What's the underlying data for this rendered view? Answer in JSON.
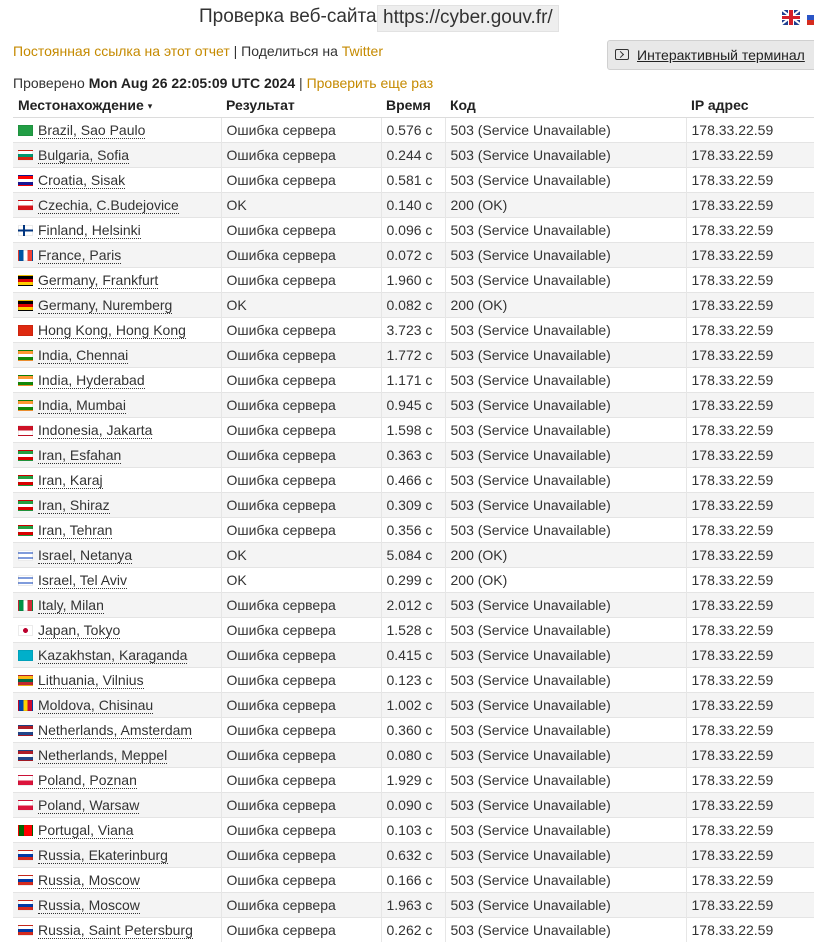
{
  "header": {
    "title": "Проверка веб-сайта",
    "url": "https://cyber.gouv.fr/"
  },
  "links": {
    "permalink": "Постоянная ссылка на этот отчет",
    "separator": "|",
    "share_prefix": "Поделиться на",
    "twitter": "Twitter"
  },
  "terminal_button": {
    "label": "Интерактивный терминал"
  },
  "checked": {
    "prefix": "Проверено",
    "datetime": "Mon Aug 26 22:05:09 UTC 2024",
    "separator": "|",
    "recheck": "Проверить еще раз"
  },
  "table": {
    "headers": {
      "location": "Местонахождение",
      "sort_arrow": "▾",
      "result": "Результат",
      "time": "Время",
      "code": "Код",
      "ip": "IP адрес"
    },
    "rows": [
      {
        "flag": "br",
        "location": "Brazil, Sao Paulo",
        "result": "Ошибка сервера",
        "time": "0.576 с",
        "code": "503 (Service Unavailable)",
        "ip": "178.33.22.59",
        "error": true
      },
      {
        "flag": "bg",
        "location": "Bulgaria, Sofia",
        "result": "Ошибка сервера",
        "time": "0.244 с",
        "code": "503 (Service Unavailable)",
        "ip": "178.33.22.59",
        "error": true
      },
      {
        "flag": "hr",
        "location": "Croatia, Sisak",
        "result": "Ошибка сервера",
        "time": "0.581 с",
        "code": "503 (Service Unavailable)",
        "ip": "178.33.22.59",
        "error": true
      },
      {
        "flag": "cz",
        "location": "Czechia, C.Budejovice",
        "result": "OK",
        "time": "0.140 с",
        "code": "200 (OK)",
        "ip": "178.33.22.59",
        "error": false
      },
      {
        "flag": "fi",
        "location": "Finland, Helsinki",
        "result": "Ошибка сервера",
        "time": "0.096 с",
        "code": "503 (Service Unavailable)",
        "ip": "178.33.22.59",
        "error": true
      },
      {
        "flag": "fr",
        "location": "France, Paris",
        "result": "Ошибка сервера",
        "time": "0.072 с",
        "code": "503 (Service Unavailable)",
        "ip": "178.33.22.59",
        "error": true
      },
      {
        "flag": "de",
        "location": "Germany, Frankfurt",
        "result": "Ошибка сервера",
        "time": "1.960 с",
        "code": "503 (Service Unavailable)",
        "ip": "178.33.22.59",
        "error": true
      },
      {
        "flag": "de",
        "location": "Germany, Nuremberg",
        "result": "OK",
        "time": "0.082 с",
        "code": "200 (OK)",
        "ip": "178.33.22.59",
        "error": false
      },
      {
        "flag": "hk",
        "location": "Hong Kong, Hong Kong",
        "result": "Ошибка сервера",
        "time": "3.723 с",
        "code": "503 (Service Unavailable)",
        "ip": "178.33.22.59",
        "error": true
      },
      {
        "flag": "in",
        "location": "India, Chennai",
        "result": "Ошибка сервера",
        "time": "1.772 с",
        "code": "503 (Service Unavailable)",
        "ip": "178.33.22.59",
        "error": true
      },
      {
        "flag": "in",
        "location": "India, Hyderabad",
        "result": "Ошибка сервера",
        "time": "1.171 с",
        "code": "503 (Service Unavailable)",
        "ip": "178.33.22.59",
        "error": true
      },
      {
        "flag": "in",
        "location": "India, Mumbai",
        "result": "Ошибка сервера",
        "time": "0.945 с",
        "code": "503 (Service Unavailable)",
        "ip": "178.33.22.59",
        "error": true
      },
      {
        "flag": "id",
        "location": "Indonesia, Jakarta",
        "result": "Ошибка сервера",
        "time": "1.598 с",
        "code": "503 (Service Unavailable)",
        "ip": "178.33.22.59",
        "error": true
      },
      {
        "flag": "ir",
        "location": "Iran, Esfahan",
        "result": "Ошибка сервера",
        "time": "0.363 с",
        "code": "503 (Service Unavailable)",
        "ip": "178.33.22.59",
        "error": true
      },
      {
        "flag": "ir",
        "location": "Iran, Karaj",
        "result": "Ошибка сервера",
        "time": "0.466 с",
        "code": "503 (Service Unavailable)",
        "ip": "178.33.22.59",
        "error": true
      },
      {
        "flag": "ir",
        "location": "Iran, Shiraz",
        "result": "Ошибка сервера",
        "time": "0.309 с",
        "code": "503 (Service Unavailable)",
        "ip": "178.33.22.59",
        "error": true
      },
      {
        "flag": "ir",
        "location": "Iran, Tehran",
        "result": "Ошибка сервера",
        "time": "0.356 с",
        "code": "503 (Service Unavailable)",
        "ip": "178.33.22.59",
        "error": true
      },
      {
        "flag": "il",
        "location": "Israel, Netanya",
        "result": "OK",
        "time": "5.084 с",
        "code": "200 (OK)",
        "ip": "178.33.22.59",
        "error": false
      },
      {
        "flag": "il",
        "location": "Israel, Tel Aviv",
        "result": "OK",
        "time": "0.299 с",
        "code": "200 (OK)",
        "ip": "178.33.22.59",
        "error": false
      },
      {
        "flag": "it",
        "location": "Italy, Milan",
        "result": "Ошибка сервера",
        "time": "2.012 с",
        "code": "503 (Service Unavailable)",
        "ip": "178.33.22.59",
        "error": true
      },
      {
        "flag": "jp",
        "location": "Japan, Tokyo",
        "result": "Ошибка сервера",
        "time": "1.528 с",
        "code": "503 (Service Unavailable)",
        "ip": "178.33.22.59",
        "error": true
      },
      {
        "flag": "kz",
        "location": "Kazakhstan, Karaganda",
        "result": "Ошибка сервера",
        "time": "0.415 с",
        "code": "503 (Service Unavailable)",
        "ip": "178.33.22.59",
        "error": true
      },
      {
        "flag": "lt",
        "location": "Lithuania, Vilnius",
        "result": "Ошибка сервера",
        "time": "0.123 с",
        "code": "503 (Service Unavailable)",
        "ip": "178.33.22.59",
        "error": true
      },
      {
        "flag": "md",
        "location": "Moldova, Chisinau",
        "result": "Ошибка сервера",
        "time": "1.002 с",
        "code": "503 (Service Unavailable)",
        "ip": "178.33.22.59",
        "error": true
      },
      {
        "flag": "nl",
        "location": "Netherlands, Amsterdam",
        "result": "Ошибка сервера",
        "time": "0.360 с",
        "code": "503 (Service Unavailable)",
        "ip": "178.33.22.59",
        "error": true
      },
      {
        "flag": "nl",
        "location": "Netherlands, Meppel",
        "result": "Ошибка сервера",
        "time": "0.080 с",
        "code": "503 (Service Unavailable)",
        "ip": "178.33.22.59",
        "error": true
      },
      {
        "flag": "pl",
        "location": "Poland, Poznan",
        "result": "Ошибка сервера",
        "time": "1.929 с",
        "code": "503 (Service Unavailable)",
        "ip": "178.33.22.59",
        "error": true
      },
      {
        "flag": "pl",
        "location": "Poland, Warsaw",
        "result": "Ошибка сервера",
        "time": "0.090 с",
        "code": "503 (Service Unavailable)",
        "ip": "178.33.22.59",
        "error": true
      },
      {
        "flag": "pt",
        "location": "Portugal, Viana",
        "result": "Ошибка сервера",
        "time": "0.103 с",
        "code": "503 (Service Unavailable)",
        "ip": "178.33.22.59",
        "error": true
      },
      {
        "flag": "ru",
        "location": "Russia, Ekaterinburg",
        "result": "Ошибка сервера",
        "time": "0.632 с",
        "code": "503 (Service Unavailable)",
        "ip": "178.33.22.59",
        "error": true
      },
      {
        "flag": "ru",
        "location": "Russia, Moscow",
        "result": "Ошибка сервера",
        "time": "0.166 с",
        "code": "503 (Service Unavailable)",
        "ip": "178.33.22.59",
        "error": true
      },
      {
        "flag": "ru",
        "location": "Russia, Moscow",
        "result": "Ошибка сервера",
        "time": "1.963 с",
        "code": "503 (Service Unavailable)",
        "ip": "178.33.22.59",
        "error": true
      },
      {
        "flag": "ru",
        "location": "Russia, Saint Petersburg",
        "result": "Ошибка сервера",
        "time": "0.262 с",
        "code": "503 (Service Unavailable)",
        "ip": "178.33.22.59",
        "error": true
      }
    ]
  },
  "colors": {
    "link": "#c58a00",
    "error": "#d6001c",
    "row_alt": "#f4f4f4"
  }
}
